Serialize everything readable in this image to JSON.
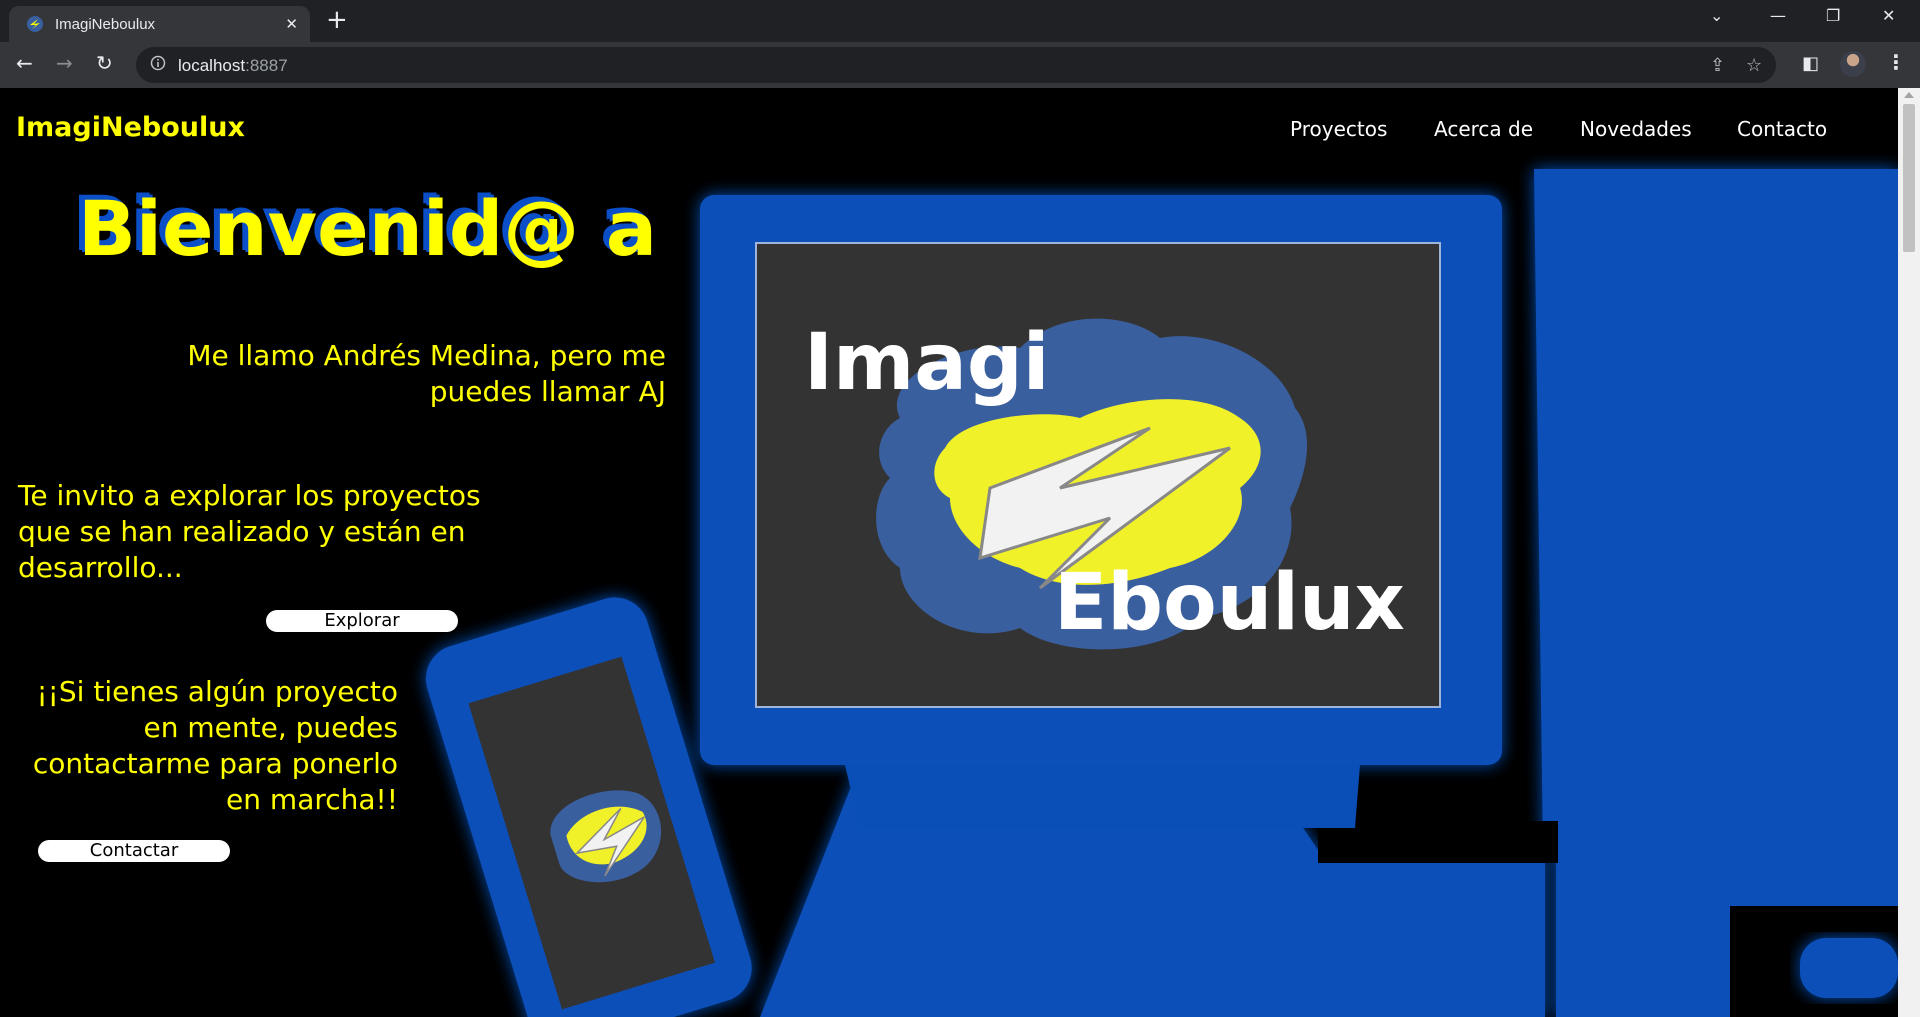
{
  "browser": {
    "tab_title": "ImagiNeboulux",
    "close_glyph": "✕",
    "new_tab_glyph": "+",
    "url_host": "localhost",
    "url_port": ":8887"
  },
  "site": {
    "logo": "ImagiNeboulux",
    "nav": [
      "Proyectos",
      "Acerca de",
      "Novedades",
      "Contacto"
    ]
  },
  "hero": {
    "welcome": "Bienvenid@ a",
    "intro": "Me llamo Andrés Medina, pero me puedes llamar AJ",
    "invite": "Te invito a explorar los proyectos que se han realizado y están en desarrollo...",
    "explore_button": "Explorar",
    "project_text": "¡¡Si tienes algún proyecto en mente, puedes contactarme para ponerlo en marcha!!",
    "contact_button": "Contactar"
  },
  "illustration": {
    "logo_word_1": "Imagi",
    "logo_word_2": "Eboulux"
  },
  "colors": {
    "accent_yellow": "#ffff00",
    "brand_blue": "#0a4fb8",
    "screen_gray": "#333333",
    "cloud_blue": "#3a5f9e"
  }
}
